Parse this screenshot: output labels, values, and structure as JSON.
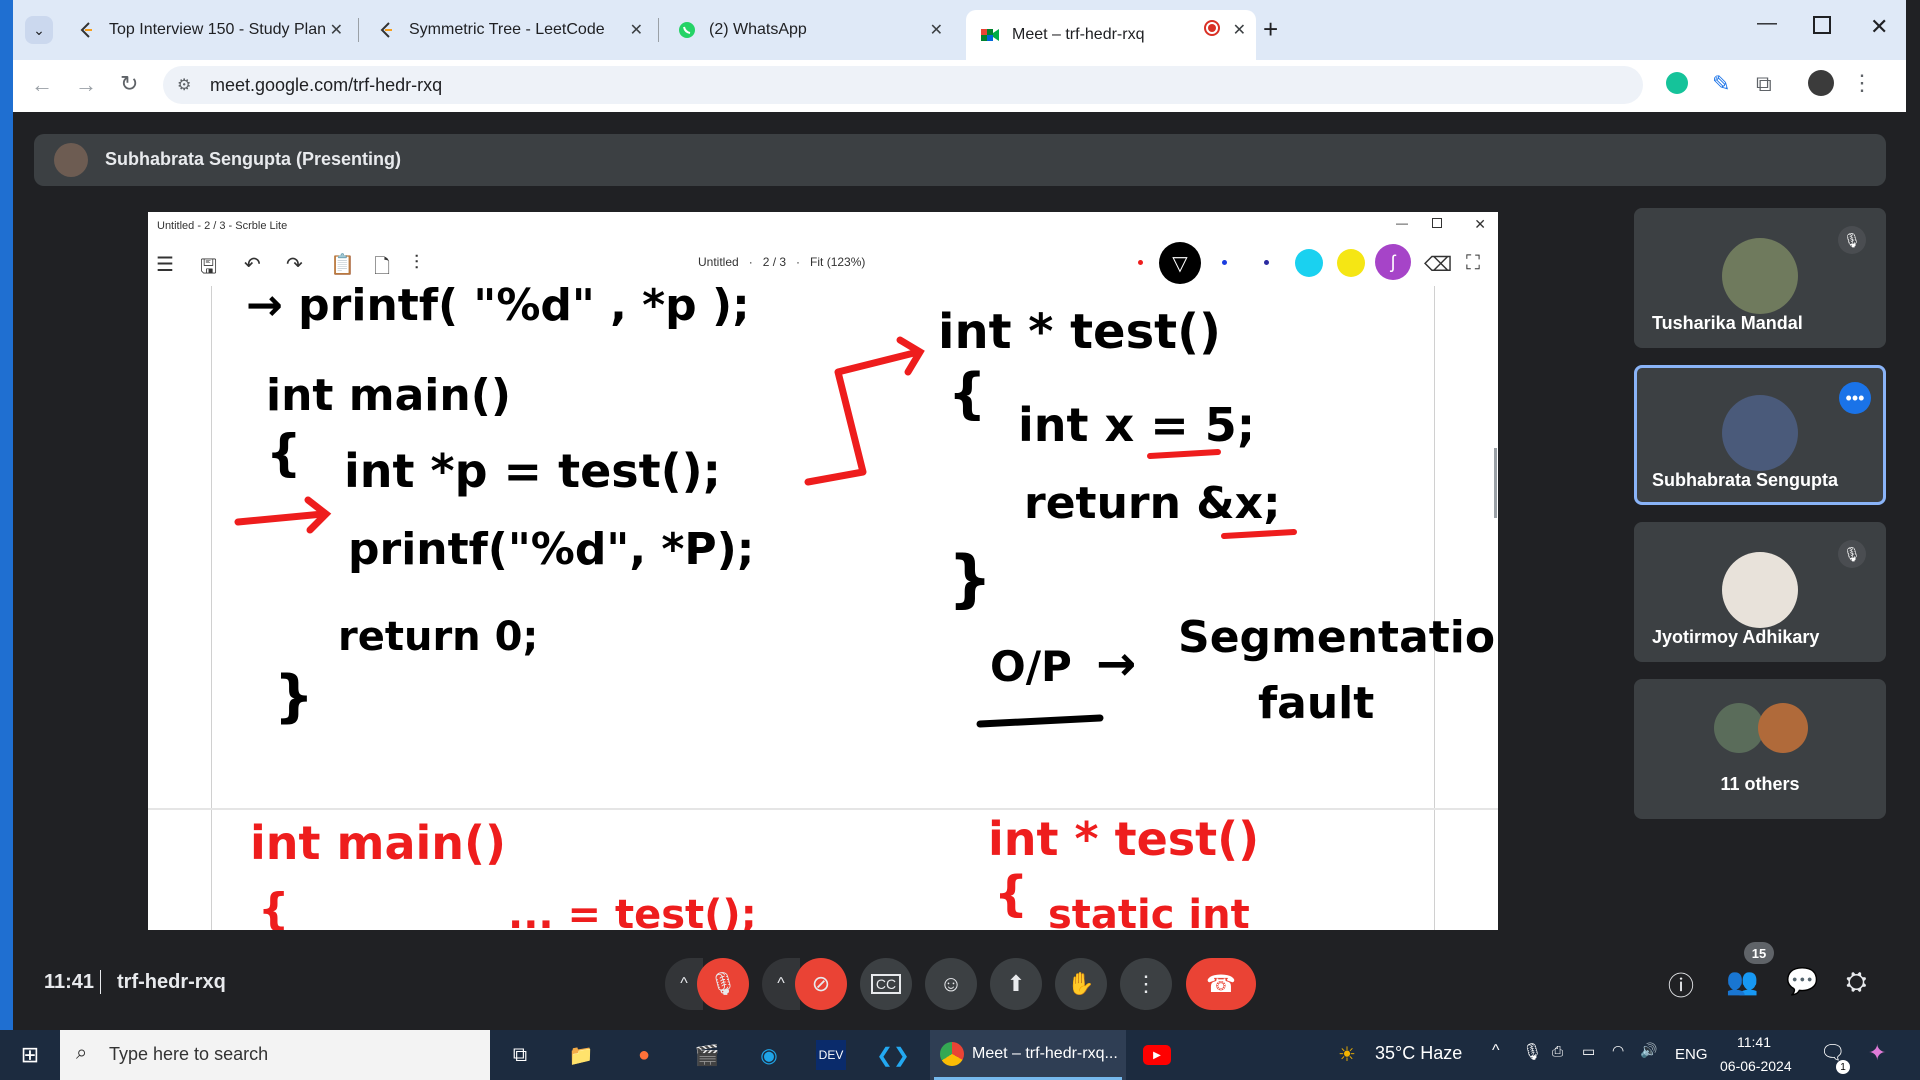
{
  "browser": {
    "tabs": [
      {
        "title": "Top Interview 150 - Study Plan",
        "icon": "leetcode-icon"
      },
      {
        "title": "Symmetric Tree - LeetCode",
        "icon": "leetcode-icon"
      },
      {
        "title": "(2) WhatsApp",
        "icon": "whatsapp-icon"
      },
      {
        "title": "Meet – trf-hedr-rxq",
        "icon": "google-meet-icon",
        "active": true
      }
    ],
    "url": "meet.google.com/trf-hedr-rxq"
  },
  "meet": {
    "presenter_label": "Subhabrata Sengupta (Presenting)",
    "time": "11:41",
    "meeting_code": "trf-hedr-rxq",
    "participant_count": "15",
    "participants": [
      {
        "name": "Tusharika Mandal",
        "muted": true
      },
      {
        "name": "Subhabrata Sengupta",
        "muted": false,
        "speaking": true
      },
      {
        "name": "Jyotirmoy Adhikary",
        "muted": true
      },
      {
        "name": "11 others",
        "muted": false
      }
    ]
  },
  "shared_window": {
    "title": "Untitled - 2 / 3 - Scrble Lite",
    "doc_name": "Untitled",
    "page_indicator": "2 / 3",
    "zoom": "Fit (123%)",
    "palette": [
      "#ee1d1d",
      "#000000",
      "#1a3de0",
      "#2b2ba0",
      "#1ad1f0",
      "#f5e614",
      "#a644c8"
    ],
    "handwriting": {
      "top_left": "→ printf(  \"%d\" , *p );",
      "main_sig": "int main()",
      "brace_open": "{",
      "line1": "int *p = test();",
      "line2": "printf(\"%d\", *P);",
      "line3": "return 0;",
      "brace_close": "}",
      "fn_sig": "int * test()",
      "fn_brace_open": "{",
      "fn_line1": "int x = 5;",
      "fn_line2": "return &x;",
      "fn_brace_close": "}",
      "output_label": "O/P",
      "output_arrow": "→",
      "output_text1": "Segmentation",
      "output_text2": "fault",
      "red_main": "int main()",
      "red_brace": "{",
      "red_line": "... = test();",
      "red_fn": "int * test()",
      "red_fn_brace": "{",
      "red_fn_line": "static int"
    }
  },
  "taskbar": {
    "search_placeholder": "Type here to search",
    "chrome_label": "Meet – trf-hedr-rxq...",
    "weather": "35°C  Haze",
    "lang": "ENG",
    "clock_time": "11:41",
    "clock_date": "06-06-2024",
    "notification_count": "1"
  }
}
